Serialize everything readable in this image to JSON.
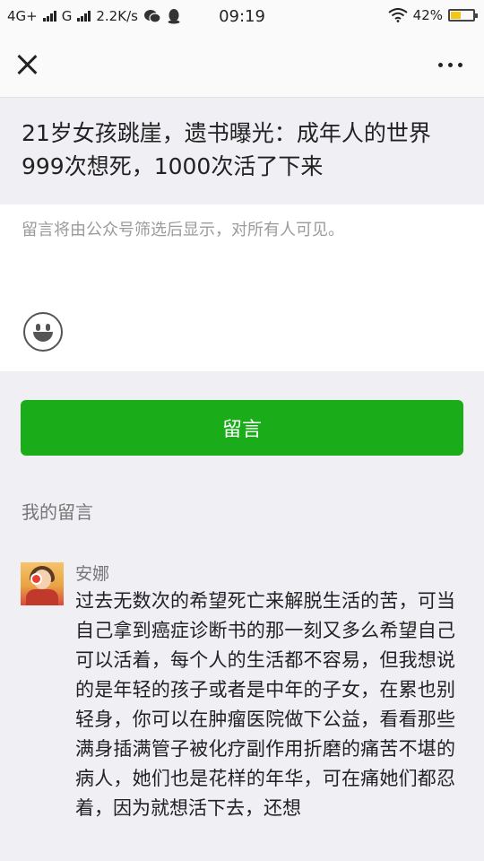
{
  "status_bar": {
    "network": "4G+",
    "network2": "G",
    "speed": "2.2K/s",
    "time": "09:19",
    "battery": "42%",
    "battery_level": 0.42
  },
  "nav": {
    "close_icon": "close-icon",
    "more_icon": "more-dots-icon"
  },
  "article": {
    "title": "21岁女孩跳崖，遗书曝光：成年人的世界999次想死，1000次活了下来"
  },
  "compose": {
    "placeholder": "留言将由公众号筛选后显示，对所有人可见。",
    "emoji_icon": "emoji-smile-icon",
    "submit_label": "留言",
    "submit_color": "#1aad19"
  },
  "my_comments": {
    "label": "我的留言",
    "items": [
      {
        "author": "安娜",
        "text": "过去无数次的希望死亡来解脱生活的苦，可当自己拿到癌症诊断书的那一刻又多么希望自己可以活着，每个人的生活都不容易，但我想说的是年轻的孩子或者是中年的子女，在累也别轻身，你可以在肿瘤医院做下公益，看看那些满身插满管子被化疗副作用折磨的痛苦不堪的病人，她们也是花样的年华，可在痛她们都忍着，因为就想活下去，还想"
      }
    ]
  }
}
